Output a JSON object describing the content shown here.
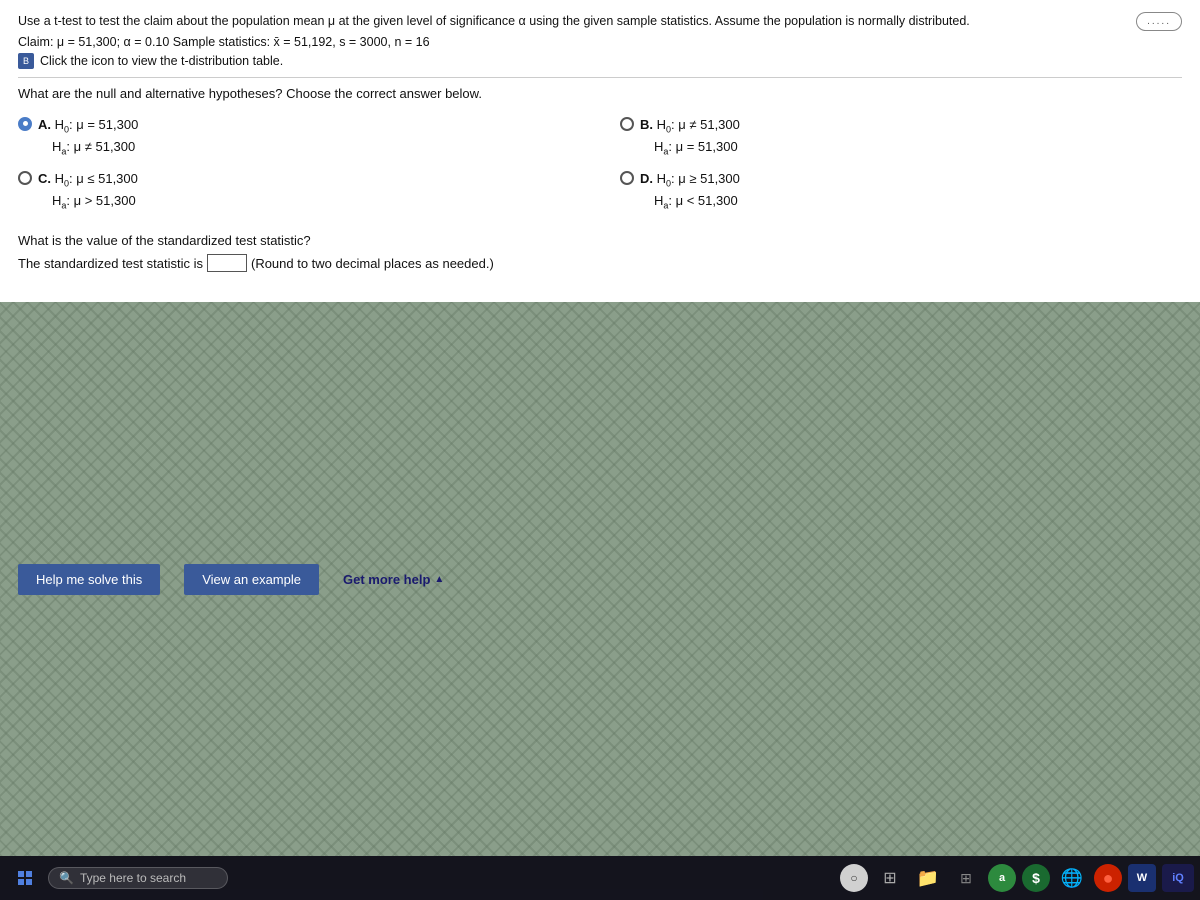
{
  "instructions": {
    "line1": "Use a t-test to test the claim about the population mean μ at the given level of significance α using the given sample statistics. Assume the population is normally distributed.",
    "line2": "Claim: μ = 51,300; α = 0.10    Sample statistics: x̄ = 51,192, s = 3000, n = 16",
    "table_link": "Click the icon to view the t-distribution table."
  },
  "question1": {
    "text": "What are the null and alternative hypotheses? Choose the correct answer below.",
    "choices": {
      "A": {
        "h0": "H₀: μ = 51,300",
        "ha": "Hₐ: μ ≠ 51,300",
        "selected": true
      },
      "B": {
        "h0": "H₀: μ ≠ 51,300",
        "ha": "Hₐ: μ = 51,300",
        "selected": false
      },
      "C": {
        "h0": "H₀: μ ≤ 51,300",
        "ha": "Hₐ: μ > 51,300",
        "selected": false
      },
      "D": {
        "h0": "H₀: μ ≥ 51,300",
        "ha": "Hₐ: μ < 51,300",
        "selected": false
      }
    }
  },
  "question2": {
    "text": "What is the value of the standardized test statistic?",
    "input_label": "The standardized test statistic is",
    "input_note": "(Round to two decimal places as needed.)"
  },
  "bottom_buttons": {
    "help": "Help me solve this",
    "example": "View an example",
    "more_help": "Get more help"
  },
  "taskbar": {
    "search_placeholder": "Type here to search",
    "circle_label": "O",
    "icons": [
      "a",
      "S",
      "W",
      "iQ"
    ]
  },
  "ellipsis": ".....",
  "book_icon": "B"
}
